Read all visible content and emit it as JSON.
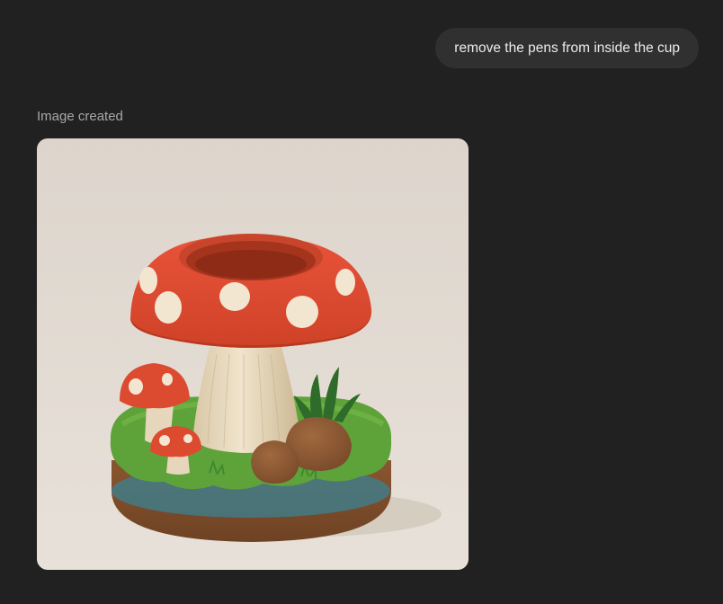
{
  "user_message": {
    "text": "remove the pens from inside the cup"
  },
  "assistant": {
    "status_label": "Image created",
    "generated_image": {
      "subject": "mushroom-pen-holder-illustration"
    }
  }
}
